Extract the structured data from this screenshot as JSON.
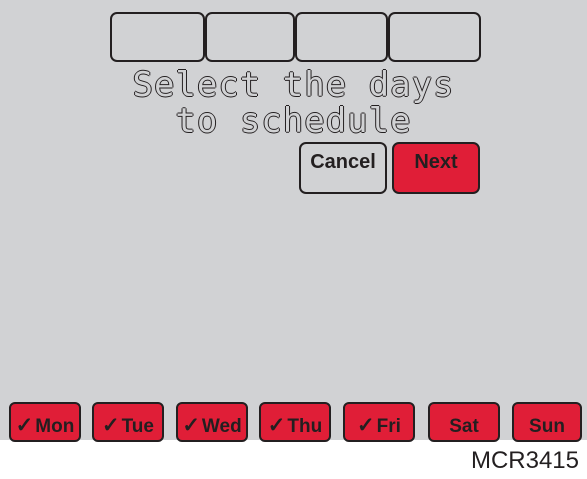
{
  "headline": {
    "line1": "Select the days",
    "line2": "to schedule"
  },
  "buttons": {
    "cancel_label": "Cancel",
    "next_label": "Next"
  },
  "days": [
    {
      "label": "Mon",
      "checked": true,
      "check_glyph": "✓"
    },
    {
      "label": "Tue",
      "checked": true,
      "check_glyph": "✓"
    },
    {
      "label": "Wed",
      "checked": true,
      "check_glyph": "✓"
    },
    {
      "label": "Thu",
      "checked": true,
      "check_glyph": "✓"
    },
    {
      "label": "Fri",
      "checked": true,
      "check_glyph": "✓"
    },
    {
      "label": "Sat",
      "checked": false,
      "check_glyph": ""
    },
    {
      "label": "Sun",
      "checked": false,
      "check_glyph": ""
    }
  ],
  "figure_id": "MCR3415",
  "colors": {
    "screen_bg": "#d1d2d4",
    "accent_red": "#e01e37",
    "outline": "#231f20"
  }
}
